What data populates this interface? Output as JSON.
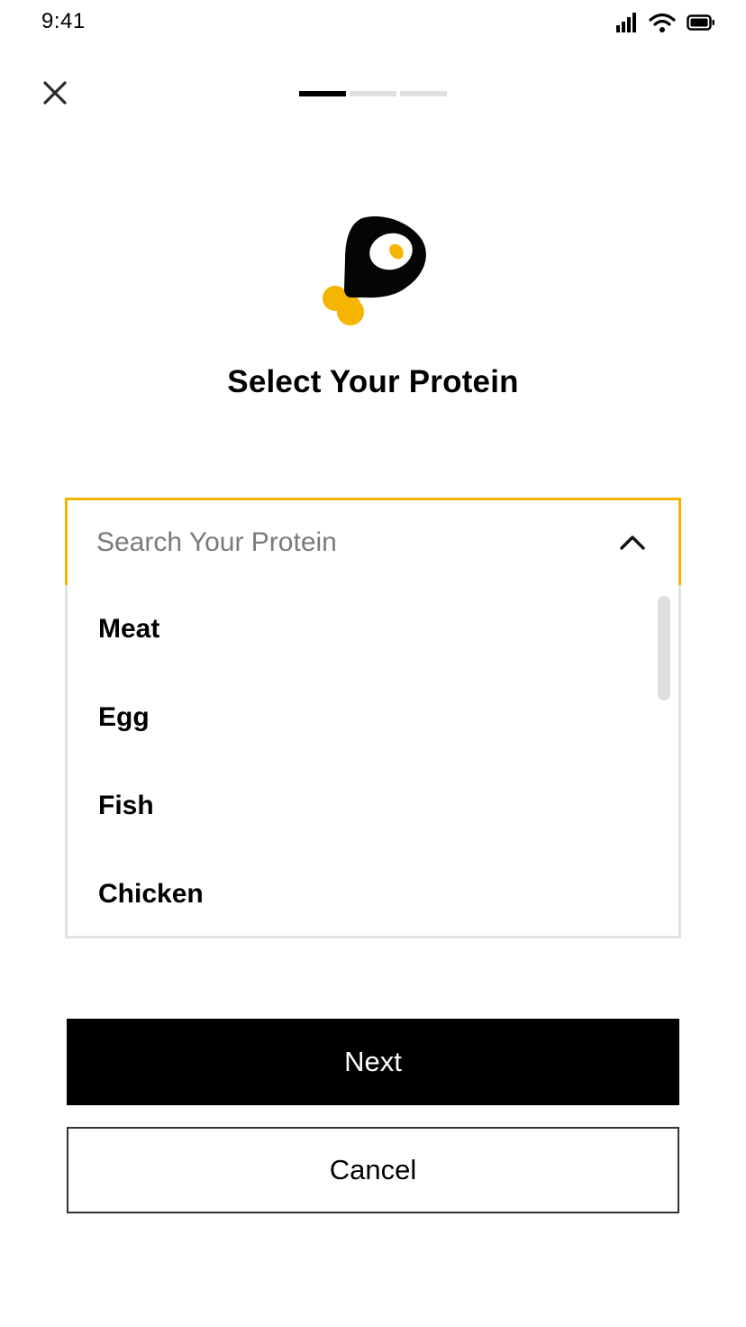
{
  "status_bar": {
    "time": "9:41",
    "icons": [
      "signal-icon",
      "wifi-icon",
      "battery-icon"
    ]
  },
  "header": {
    "close_icon": "close-icon",
    "steps": [
      {
        "state": "active"
      },
      {
        "state": "inactive"
      },
      {
        "state": "inactive"
      }
    ]
  },
  "hero": {
    "icon": "meat-drumstick-icon",
    "title": "Select Your Protein"
  },
  "search": {
    "placeholder": "Search Your Protein",
    "value": "",
    "expanded": true
  },
  "options": {
    "items": [
      {
        "label": "Meat"
      },
      {
        "label": "Egg"
      },
      {
        "label": "Fish"
      },
      {
        "label": "Chicken"
      }
    ]
  },
  "actions": {
    "next_label": "Next",
    "cancel_label": "Cancel"
  },
  "colors": {
    "accent": "#f4b400",
    "primary": "#000000",
    "border": "#e2e2e2",
    "placeholder": "#7a7a7a"
  }
}
